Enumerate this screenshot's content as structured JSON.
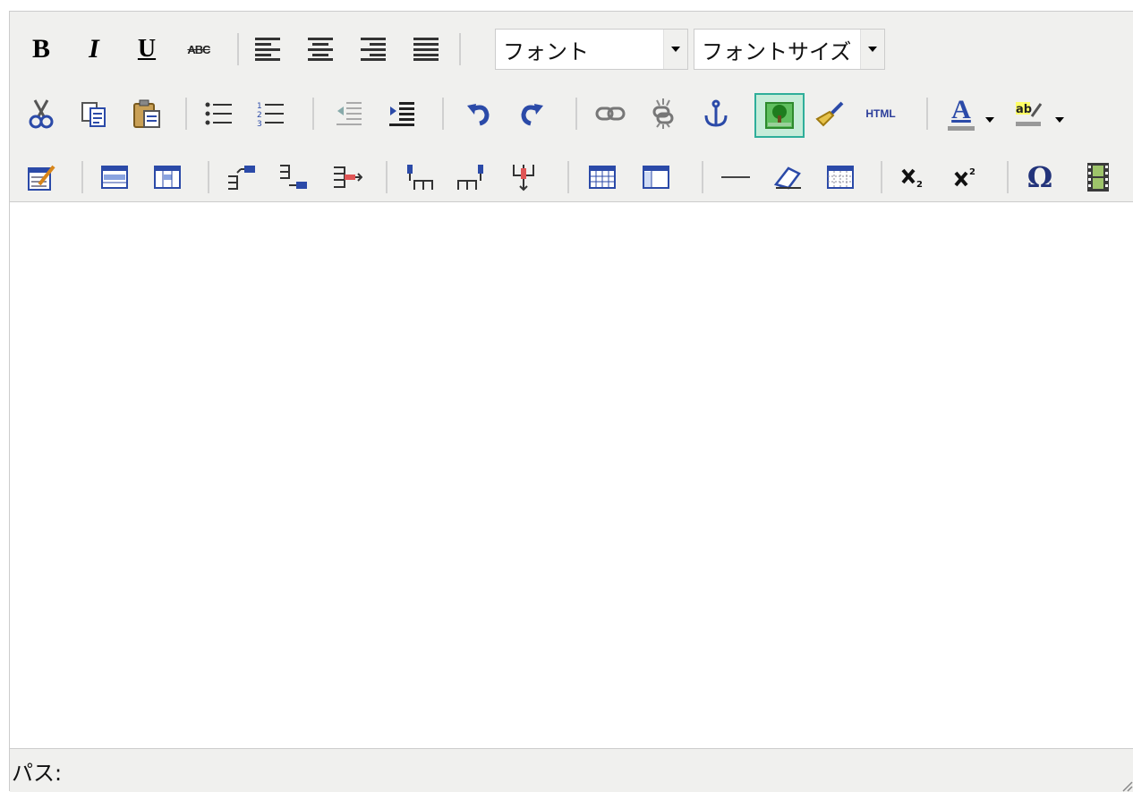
{
  "toolbar": {
    "font_select": {
      "value": "フォント"
    },
    "font_size_select": {
      "value": "フォントサイズ"
    },
    "html_label": "HTML",
    "special_char_label": "Ω",
    "text_color_label": "A"
  },
  "statusbar": {
    "path_label": "パス:"
  },
  "icons": [
    "bold",
    "italic",
    "underline",
    "strikethrough",
    "align-left",
    "align-center",
    "align-right",
    "align-justify",
    "cut",
    "copy",
    "paste",
    "bullet-list",
    "numbered-list",
    "outdent",
    "indent",
    "undo",
    "redo",
    "link",
    "unlink",
    "anchor",
    "image",
    "cleanup",
    "html",
    "text-color",
    "highlight-color",
    "edit-table",
    "row-props",
    "cell-props",
    "insert-row-before",
    "insert-row-after",
    "delete-row",
    "insert-col-before",
    "insert-col-after",
    "delete-col",
    "split-cells",
    "merge-cells",
    "horizontal-rule",
    "remove-format",
    "visual-aid",
    "subscript",
    "superscript",
    "special-char",
    "media"
  ],
  "colors": {
    "toolbar_bg": "#f0f0ee",
    "border": "#cccccc",
    "active_border": "#2fae9a",
    "active_bg": "#c6ecd9"
  }
}
